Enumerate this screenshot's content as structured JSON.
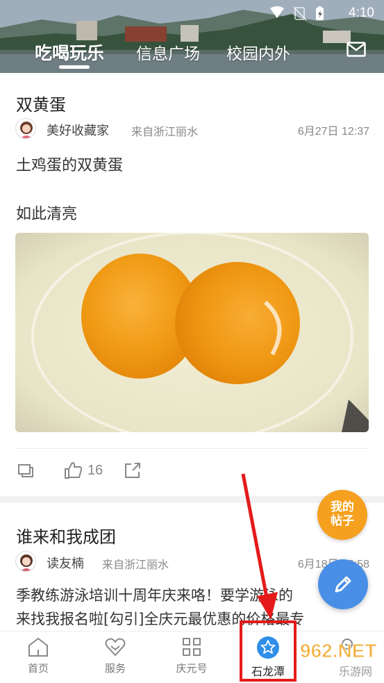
{
  "status_bar": {
    "time": "4:10"
  },
  "tabs": [
    {
      "label": "吃喝玩乐",
      "active": true
    },
    {
      "label": "信息广场",
      "active": false
    },
    {
      "label": "校园内外",
      "active": false
    }
  ],
  "header_icons": {
    "mail": "mail-icon"
  },
  "posts": [
    {
      "title": "双黄蛋",
      "author": "美好收藏家",
      "from": "来自浙江丽水",
      "time": "6月27日 12:37",
      "lines": [
        "土鸡蛋的双黄蛋",
        "如此清亮"
      ],
      "likes": "16"
    },
    {
      "title": "谁来和我成团",
      "author": "读友楠",
      "from": "来自浙江丽水",
      "time": "6月18日 16:58",
      "lines": [
        "季教练游泳培训十周年庆来咯！要学游泳的",
        "来找我报名啦[勾引]全庆元最优惠的价格最专"
      ]
    }
  ],
  "floating": {
    "my_posts_line1": "我的",
    "my_posts_line2": "帖子"
  },
  "bottom_nav": [
    {
      "label": "首页",
      "icon": "home-icon",
      "active": false
    },
    {
      "label": "服务",
      "icon": "heart-icon",
      "active": false
    },
    {
      "label": "庆元号",
      "icon": "grid-icon",
      "active": false
    },
    {
      "label": "石龙潭",
      "icon": "star-icon",
      "active": true
    },
    {
      "label": "",
      "icon": "profile-icon",
      "active": false
    }
  ],
  "watermark": {
    "brand": "962.NET",
    "sub": "乐游网"
  },
  "colors": {
    "accent_orange": "#f5a01e",
    "compose_blue": "#4a8fe7",
    "highlight_red": "#e41a1a"
  }
}
